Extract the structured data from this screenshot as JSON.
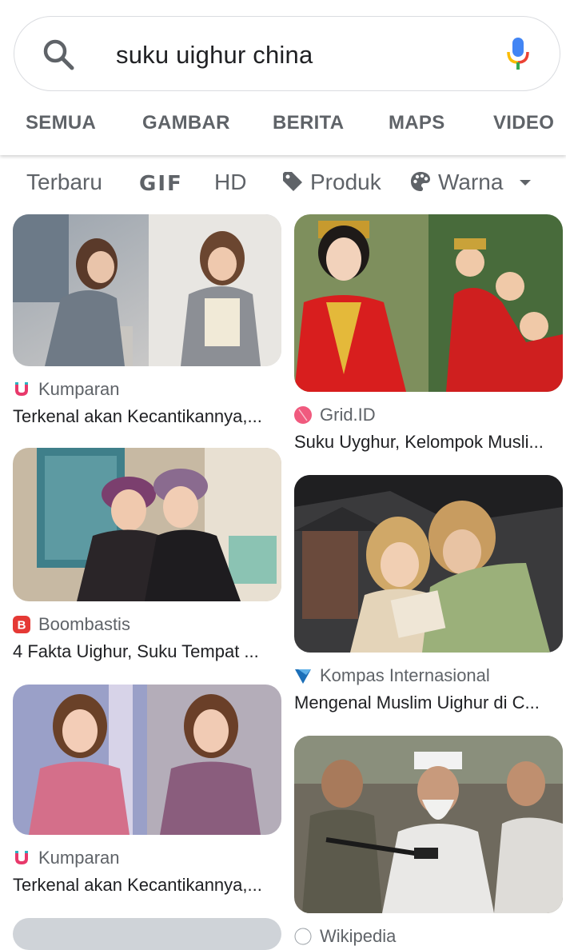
{
  "search": {
    "query": "suku uighur china"
  },
  "tabs": [
    {
      "label": "SEMUA"
    },
    {
      "label": "GAMBAR"
    },
    {
      "label": "BERITA"
    },
    {
      "label": "MAPS"
    },
    {
      "label": "VIDEO"
    }
  ],
  "chips": [
    {
      "label": "Terbaru"
    },
    {
      "label": "GIF"
    },
    {
      "label": "HD"
    },
    {
      "label": "Produk",
      "icon": "tag-icon"
    },
    {
      "label": "Warna",
      "icon": "palette-icon"
    }
  ],
  "results_left": [
    {
      "source": "Kumparan",
      "title": "Terkenal akan Kecantikannya,...",
      "favicon": "kumparan-icon"
    },
    {
      "source": "Boombastis",
      "title": "4 Fakta Uighur, Suku Tempat ...",
      "favicon": "boombastis-icon"
    },
    {
      "source": "Kumparan",
      "title": "Terkenal akan Kecantikannya,...",
      "favicon": "kumparan-icon"
    }
  ],
  "results_right": [
    {
      "source": "Grid.ID",
      "title": "Suku Uyghur, Kelompok Musli...",
      "favicon": "gridid-icon"
    },
    {
      "source": "Kompas Internasional",
      "title": "Mengenal Muslim Uighur di C...",
      "favicon": "kompas-icon"
    },
    {
      "source": "Wikipedia",
      "title": "",
      "favicon": "wikipedia-icon"
    }
  ],
  "colors": {
    "google_blue": "#4285f4",
    "google_red": "#ea4335",
    "google_yellow": "#fbbc05",
    "google_green": "#34a853",
    "muted": "#5f6368"
  }
}
